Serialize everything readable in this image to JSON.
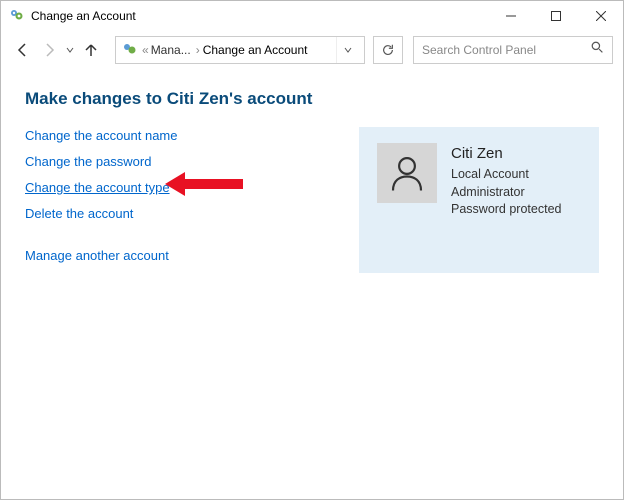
{
  "titlebar": {
    "title": "Change an Account"
  },
  "breadcrumb": {
    "parent": "Mana...",
    "current": "Change an Account"
  },
  "search": {
    "placeholder": "Search Control Panel"
  },
  "heading": "Make changes to Citi Zen's account",
  "links": {
    "change_name": "Change the account name",
    "change_password": "Change the password",
    "change_type": "Change the account type",
    "delete": "Delete the account",
    "manage_another": "Manage another account"
  },
  "account": {
    "name": "Citi Zen",
    "type": "Local Account",
    "role": "Administrator",
    "protection": "Password protected"
  }
}
